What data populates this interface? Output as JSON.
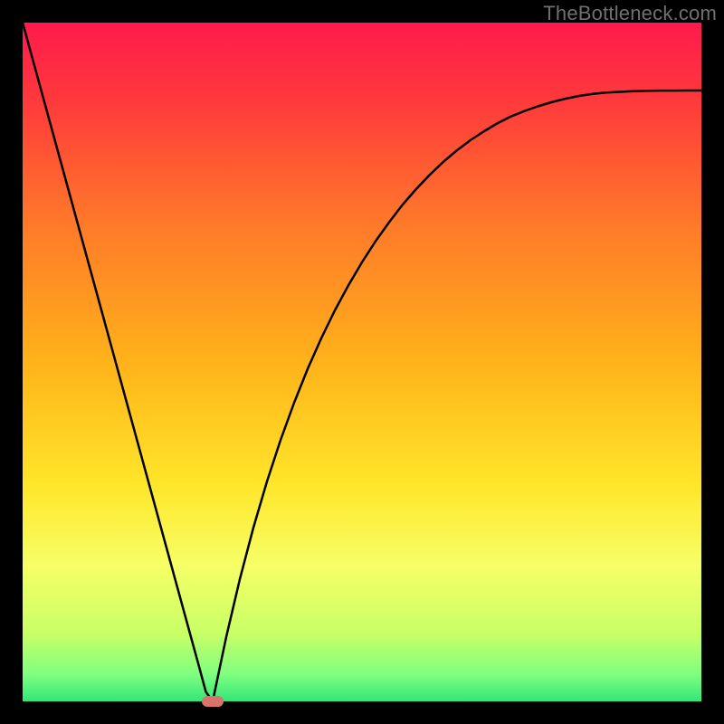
{
  "watermark": {
    "text": "TheBottleneck.com"
  },
  "colors": {
    "frame": "#000000",
    "curve": "#000000",
    "marker": "#d9746c",
    "gradient_stops": [
      {
        "p": 0,
        "c": "#ff1a4d"
      },
      {
        "p": 12,
        "c": "#ff3b3b"
      },
      {
        "p": 30,
        "c": "#ff7a29"
      },
      {
        "p": 50,
        "c": "#ffb21a"
      },
      {
        "p": 68,
        "c": "#ffe629"
      },
      {
        "p": 80,
        "c": "#f6ff66"
      },
      {
        "p": 90,
        "c": "#c9ff66"
      },
      {
        "p": 96,
        "c": "#7fff7f"
      },
      {
        "p": 100,
        "c": "#33e67a"
      }
    ]
  },
  "chart_data": {
    "type": "line",
    "title": "",
    "xlabel": "",
    "ylabel": "",
    "xlim": [
      0,
      100
    ],
    "ylim": [
      0,
      100
    ],
    "grid": false,
    "curve_x": [
      0,
      2,
      4,
      6,
      8,
      10,
      12,
      14,
      16,
      18,
      20,
      22,
      24,
      26,
      27,
      28,
      30,
      32,
      34,
      36,
      38,
      40,
      42,
      44,
      46,
      48,
      50,
      52,
      54,
      56,
      58,
      60,
      62,
      64,
      66,
      68,
      70,
      72,
      74,
      76,
      78,
      80,
      82,
      84,
      86,
      88,
      90,
      92,
      94,
      96,
      98,
      100
    ],
    "curve_y": [
      100,
      92.7,
      85.4,
      78.1,
      70.8,
      63.5,
      56.2,
      48.9,
      41.6,
      34.3,
      27.0,
      19.7,
      12.4,
      5.1,
      1.4,
      0.0,
      9.5,
      18.0,
      25.6,
      32.4,
      38.5,
      44.0,
      49.0,
      53.5,
      57.6,
      61.3,
      64.7,
      67.8,
      70.6,
      73.2,
      75.5,
      77.6,
      79.5,
      81.2,
      82.7,
      84.0,
      85.2,
      86.2,
      87.0,
      87.7,
      88.3,
      88.8,
      89.2,
      89.5,
      89.7,
      89.8,
      89.9,
      89.95,
      89.98,
      89.99,
      90.0,
      90.0
    ],
    "min_point": {
      "x": 28,
      "y": 0
    },
    "marker": {
      "x": 28,
      "y": 0,
      "w_pct": 3.2,
      "h_pct": 1.6
    }
  }
}
